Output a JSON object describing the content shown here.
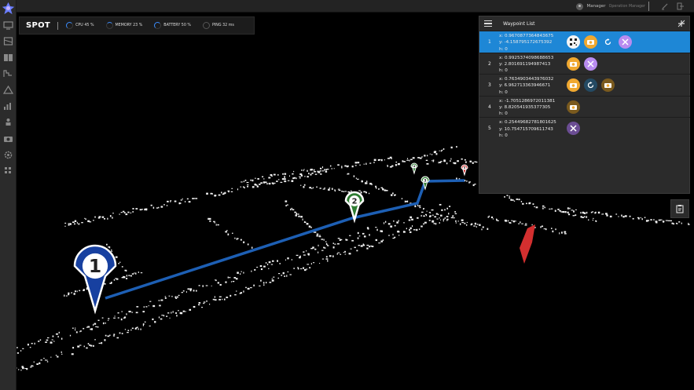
{
  "app": {
    "robot_name": "SPOT",
    "metrics": [
      {
        "icon": "cpu-ring-icon",
        "text": "CPU 45 %"
      },
      {
        "icon": "memory-ring-icon",
        "text": "MEMORY 23 %"
      },
      {
        "icon": "battery-ring-icon",
        "text": "BATTERY 50 %"
      },
      {
        "icon": "ping-ring-icon",
        "text": "PING 32 ms"
      }
    ]
  },
  "user": {
    "name": "Manager",
    "role": "Operation Manager"
  },
  "rail_icons": [
    "monitor-icon",
    "map-icon",
    "book-icon",
    "stairs-icon",
    "robot-icon",
    "chart-icon",
    "person-icon",
    "camera-icon",
    "gear-icon",
    "grid-icon"
  ],
  "panel": {
    "title": "Waypoint List",
    "waypoints": [
      {
        "num": "1",
        "x": "x: 0.9670877364843675",
        "y": "y: -4.158795172675392",
        "h": "h: 0",
        "actions": [
          "qr",
          "camera",
          "rotate",
          "magnet"
        ]
      },
      {
        "num": "2",
        "x": "x: 0.9925374098688653",
        "y": "y: 2.801691194987413",
        "h": "h: 0",
        "actions": [
          "camera",
          "magnet"
        ]
      },
      {
        "num": "3",
        "x": "x: 0.7634903443976032",
        "y": "y: 6.962713363946671",
        "h": "h: 0",
        "actions": [
          "camera",
          "rotate",
          "camera"
        ]
      },
      {
        "num": "4",
        "x": "x: -1.7051286972011381",
        "y": "y: 8.820541935377305",
        "h": "h: 0",
        "actions": [
          "camera"
        ]
      },
      {
        "num": "5",
        "x": "x: 0.25449682781801625",
        "y": "y: 10.754715709611743",
        "h": "h: 0",
        "actions": [
          "magnet"
        ]
      }
    ]
  },
  "scene": {
    "markers": [
      {
        "label": "1",
        "color": "#1740a0"
      },
      {
        "label": "2",
        "color": "#2e7d32"
      },
      {
        "label": "3",
        "color": "#2e7d32"
      },
      {
        "label": "4",
        "color": "#2e7d32"
      },
      {
        "label": "5",
        "color": "#d32f2f"
      }
    ],
    "path_color": "#1d5fb4"
  },
  "colors": {
    "selected": "#1e87d6",
    "camera": "#f0a830",
    "magnet": "#b88cf0"
  }
}
